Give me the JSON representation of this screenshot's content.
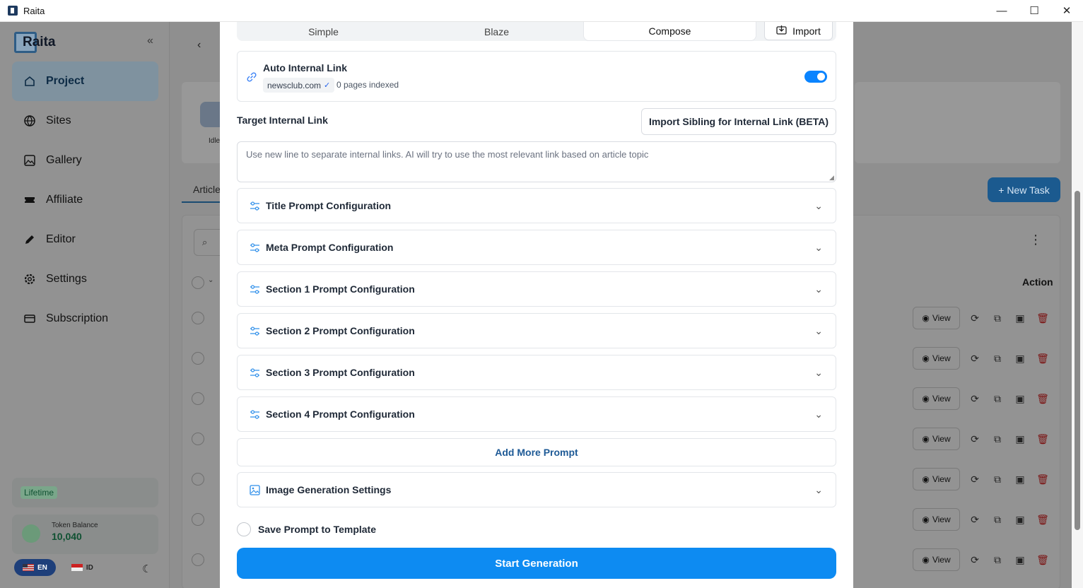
{
  "window": {
    "title": "Raita",
    "minimize": "—",
    "maximize": "☐",
    "close": "✕"
  },
  "sidebar": {
    "logo": "Raita",
    "items": [
      {
        "label": "Project",
        "icon": "home-icon"
      },
      {
        "label": "Sites",
        "icon": "globe-icon"
      },
      {
        "label": "Gallery",
        "icon": "image-icon"
      },
      {
        "label": "Affiliate",
        "icon": "ticket-icon"
      },
      {
        "label": "Editor",
        "icon": "pencil-icon"
      },
      {
        "label": "Settings",
        "icon": "gear-icon"
      },
      {
        "label": "Subscription",
        "icon": "card-icon"
      }
    ],
    "plan": "Lifetime",
    "token_label": "Token Balance",
    "token_value": "10,040",
    "lang_en": "EN",
    "lang_id": "ID"
  },
  "background": {
    "new_task": "+ New Task",
    "action_header": "Action",
    "view_label": "View",
    "tab_partial": "Article",
    "card_partial": "Idle"
  },
  "modal": {
    "tabs": [
      "Simple",
      "Blaze",
      "Compose"
    ],
    "active_tab": "Compose",
    "import_label": "Import",
    "auto_link": {
      "title": "Auto Internal Link",
      "domain": "newsclub.com",
      "pages": "0 pages indexed",
      "enabled": true
    },
    "target_label": "Target Internal Link",
    "sibling_button": "Import Sibling for Internal Link (BETA)",
    "links_placeholder": "Use new line to separate internal links. AI will try to use the most relevant link based on article topic",
    "prompt_sections": [
      "Title Prompt Configuration",
      "Meta Prompt Configuration",
      "Section 1 Prompt Configuration",
      "Section 2 Prompt Configuration",
      "Section 3 Prompt Configuration",
      "Section 4 Prompt Configuration"
    ],
    "add_more": "Add More Prompt",
    "image_settings": "Image Generation Settings",
    "save_template": "Save Prompt to Template",
    "start": "Start Generation"
  },
  "colors": {
    "accent": "#0d8bf2",
    "icon": "#2f8fea"
  }
}
